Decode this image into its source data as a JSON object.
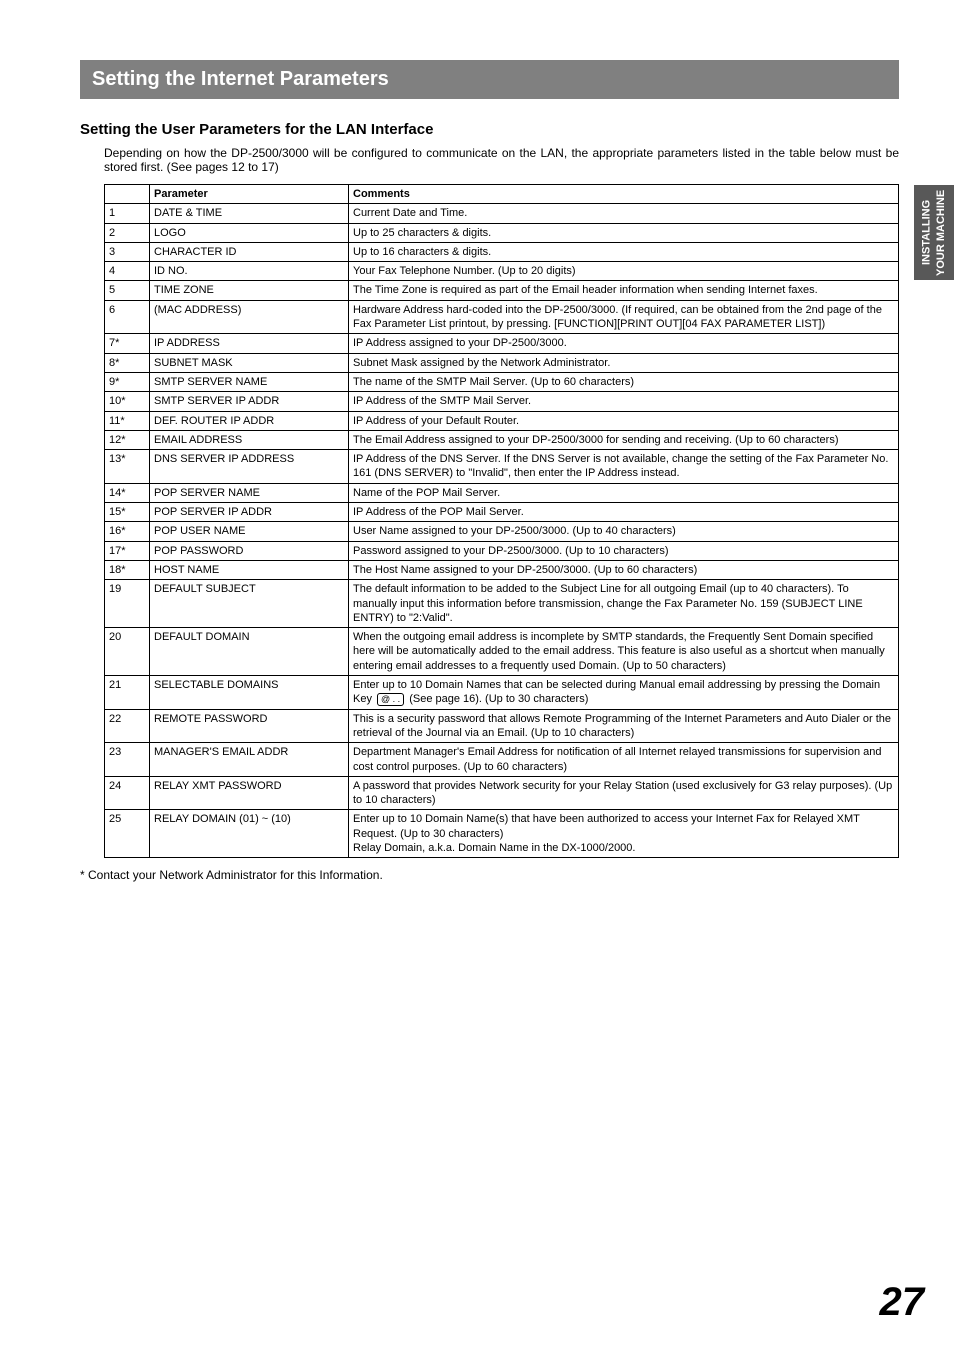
{
  "side_tab": "INSTALLING YOUR MACHINE",
  "section_title": "Setting the Internet Parameters",
  "sub_heading": "Setting the User Parameters for the LAN Interface",
  "intro_text": "Depending on how the DP-2500/3000 will be configured to communicate on the LAN, the appropriate parameters listed in the table below must be stored first. (See pages 12 to 17)",
  "table_headers": {
    "c1": "",
    "c2": "Parameter",
    "c3": "Comments"
  },
  "rows": [
    {
      "n": "1",
      "p": "DATE & TIME",
      "c": "Current Date and Time."
    },
    {
      "n": "2",
      "p": "LOGO",
      "c": "Up to 25 characters & digits."
    },
    {
      "n": "3",
      "p": "CHARACTER ID",
      "c": "Up to 16 characters & digits."
    },
    {
      "n": "4",
      "p": "ID NO.",
      "c": "Your Fax Telephone Number. (Up to 20 digits)"
    },
    {
      "n": "5",
      "p": "TIME ZONE",
      "c": "The Time Zone is required as part of the Email header information when sending Internet faxes."
    },
    {
      "n": "6",
      "p": "(MAC ADDRESS)",
      "c": "Hardware Address hard-coded into the DP-2500/3000. (If required, can be obtained from the 2nd page of the Fax Parameter List printout, by pressing. [FUNCTION][PRINT OUT][04 FAX PARAMETER LIST])"
    },
    {
      "n": "7*",
      "p": "IP ADDRESS",
      "c": "IP Address assigned to your DP-2500/3000."
    },
    {
      "n": "8*",
      "p": "SUBNET MASK",
      "c": "Subnet Mask assigned by the Network Administrator."
    },
    {
      "n": "9*",
      "p": "SMTP SERVER NAME",
      "c": "The name of the SMTP Mail Server. (Up to 60 characters)"
    },
    {
      "n": "10*",
      "p": "SMTP SERVER IP ADDR",
      "c": "IP Address of the SMTP Mail Server."
    },
    {
      "n": "11*",
      "p": "DEF. ROUTER IP ADDR",
      "c": "IP Address of your Default Router."
    },
    {
      "n": "12*",
      "p": "EMAIL ADDRESS",
      "c": "The Email Address assigned to your DP-2500/3000 for sending and receiving. (Up to 60 characters)"
    },
    {
      "n": "13*",
      "p": "DNS SERVER IP ADDRESS",
      "c": "IP Address of the DNS Server.  If the DNS Server is not available, change the setting of the Fax Parameter No. 161 (DNS SERVER) to \"Invalid\", then enter the IP Address instead."
    },
    {
      "n": "14*",
      "p": "POP SERVER NAME",
      "c": "Name of the POP Mail Server."
    },
    {
      "n": "15*",
      "p": "POP SERVER IP ADDR",
      "c": "IP Address of the POP Mail Server."
    },
    {
      "n": "16*",
      "p": "POP USER NAME",
      "c": "User Name assigned to your DP-2500/3000. (Up to 40 characters)"
    },
    {
      "n": "17*",
      "p": "POP PASSWORD",
      "c": "Password assigned to your DP-2500/3000. (Up to 10 characters)"
    },
    {
      "n": "18*",
      "p": "HOST NAME",
      "c": "The Host Name assigned to your DP-2500/3000. (Up to 60 characters)"
    },
    {
      "n": "19",
      "p": "DEFAULT SUBJECT",
      "c": "The default information to be added to the Subject Line for all outgoing Email (up to 40 characters).  To manually input this information before transmission, change the Fax Parameter No. 159 (SUBJECT LINE ENTRY) to \"2:Valid\"."
    },
    {
      "n": "20",
      "p": "DEFAULT DOMAIN",
      "c": "When the outgoing email address is incomplete by SMTP standards, the Frequently Sent Domain specified here will be automatically added to the email address. This feature is also useful as a shortcut when manually entering email addresses to a frequently used Domain. (Up to 50 characters)"
    },
    {
      "n": "21",
      "p": "SELECTABLE DOMAINS",
      "c_pre": "Enter up to 10 Domain Names that can be selected during Manual email addressing by pressing the Domain Key ",
      "key": "@ . .",
      "c_post": " (See page 16). (Up to 30 characters)"
    },
    {
      "n": "22",
      "p": "REMOTE PASSWORD",
      "c": "This is a security password that allows Remote Programming of the Internet Parameters and Auto Dialer or the retrieval of the Journal via an Email.  (Up to 10 characters)"
    },
    {
      "n": "23",
      "p": "MANAGER'S EMAIL ADDR",
      "c": "Department Manager's Email Address for notification of all Internet relayed transmissions for supervision and cost control purposes. (Up to 60 characters)"
    },
    {
      "n": "24",
      "p": "RELAY XMT PASSWORD",
      "c": "A password that provides Network security for your Relay Station (used exclusively for G3 relay purposes). (Up to 10 characters)"
    },
    {
      "n": "25",
      "p": "RELAY DOMAIN (01) ~ (10)",
      "c": "Enter up to 10 Domain Name(s) that have been authorized to access your Internet Fax for Relayed XMT Request. (Up to 30 characters)\nRelay Domain, a.k.a. Domain Name in the DX-1000/2000."
    }
  ],
  "footnote": "* Contact your Network Administrator for this Information.",
  "page_number": "27"
}
